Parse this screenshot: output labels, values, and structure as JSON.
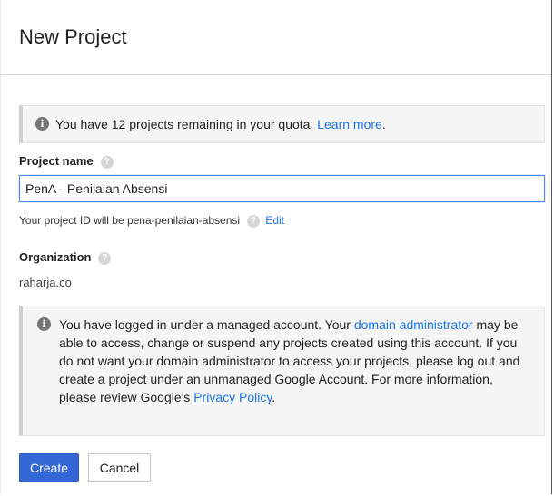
{
  "dialog": {
    "title": "New Project"
  },
  "quota_notice": {
    "icon": "info-icon",
    "text": "You have 12 projects remaining in your quota. ",
    "link": "Learn more",
    "after": "."
  },
  "project_name": {
    "label": "Project name",
    "value": "PenA - Penilaian Absensi"
  },
  "project_id": {
    "text": "Your project ID will be pena-penilaian-absensi",
    "edit_label": "Edit"
  },
  "organization": {
    "label": "Organization",
    "value": "raharja.co"
  },
  "managed_notice": {
    "part1": "You have logged in under a managed account. Your ",
    "link1": "domain administrator",
    "part2": " may be able to access, change or suspend any projects created using this account. If you do not want your domain administrator to access your projects, please log out and create a project under an unmanaged Google Account. For more information, please review Google's ",
    "link2": "Privacy Policy",
    "part3": "."
  },
  "actions": {
    "create_label": "Create",
    "cancel_label": "Cancel"
  },
  "colors": {
    "primary": "#3367d6",
    "link": "#1a73e8",
    "focus": "#4285f4"
  }
}
